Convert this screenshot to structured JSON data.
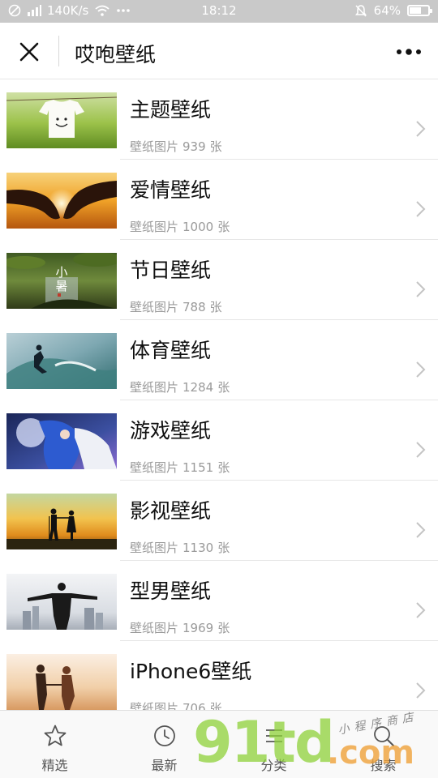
{
  "status_bar": {
    "network_speed": "140K/s",
    "time": "18:12",
    "battery": "64%",
    "battery_level": 0.64
  },
  "header": {
    "title": "哎咆壁纸"
  },
  "list": {
    "items": [
      {
        "title": "主题壁纸",
        "meta_label": "壁纸图片",
        "count": "939",
        "unit": "张",
        "thumb": "t-shirt"
      },
      {
        "title": "爱情壁纸",
        "meta_label": "壁纸图片",
        "count": "1000",
        "unit": "张",
        "thumb": "heart-hands"
      },
      {
        "title": "节日壁纸",
        "meta_label": "壁纸图片",
        "count": "788",
        "unit": "张",
        "thumb": "lotus",
        "thumb_caption": "小暑"
      },
      {
        "title": "体育壁纸",
        "meta_label": "壁纸图片",
        "count": "1284",
        "unit": "张",
        "thumb": "surfer"
      },
      {
        "title": "游戏壁纸",
        "meta_label": "壁纸图片",
        "count": "1151",
        "unit": "张",
        "thumb": "game-character"
      },
      {
        "title": "影视壁纸",
        "meta_label": "壁纸图片",
        "count": "1130",
        "unit": "张",
        "thumb": "couple-sunset"
      },
      {
        "title": "型男壁纸",
        "meta_label": "壁纸图片",
        "count": "1969",
        "unit": "张",
        "thumb": "man-city"
      },
      {
        "title": "iPhone6壁纸",
        "meta_label": "壁纸图片",
        "count": "706",
        "unit": "张",
        "thumb": "couple-walking"
      }
    ]
  },
  "tab_bar": {
    "tabs": [
      {
        "label": "精选",
        "icon": "star-icon"
      },
      {
        "label": "最新",
        "icon": "clock-icon"
      },
      {
        "label": "分类",
        "icon": "list-icon"
      },
      {
        "label": "搜索",
        "icon": "search-icon"
      }
    ]
  },
  "watermark": {
    "logo": "91td",
    "domain": ".com",
    "handwriting": "小程序商店"
  }
}
